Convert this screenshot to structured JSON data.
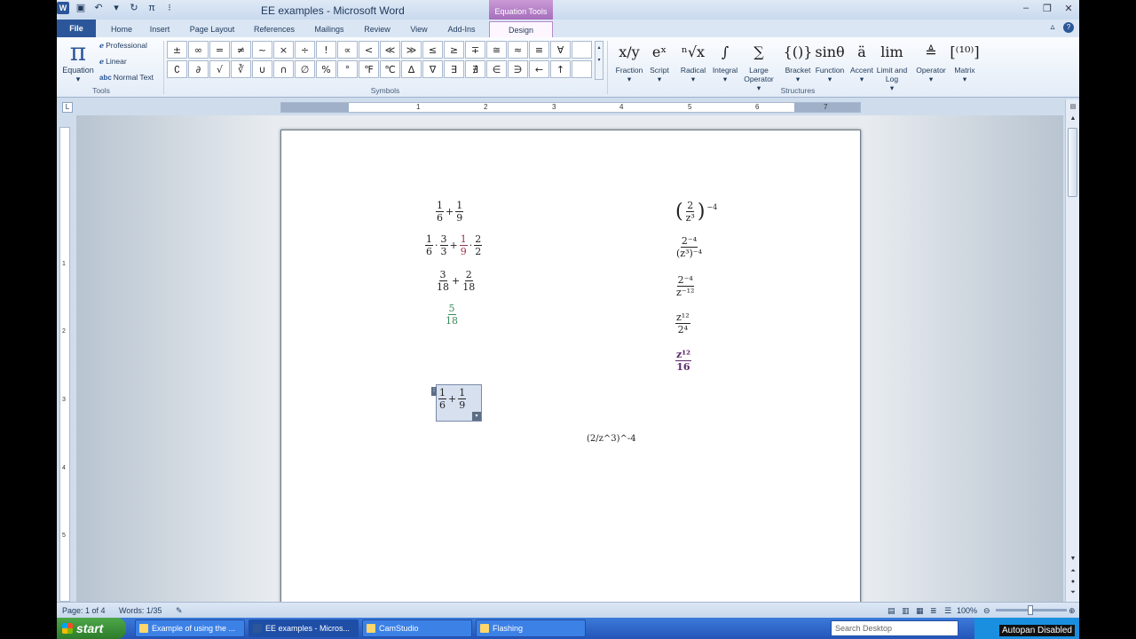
{
  "window": {
    "title": "EE examples - Microsoft Word",
    "context_tab": "Equation Tools"
  },
  "tabs": [
    "File",
    "Home",
    "Insert",
    "Page Layout",
    "References",
    "Mailings",
    "Review",
    "View",
    "Add-Ins",
    "Design"
  ],
  "ribbon": {
    "tools": {
      "equation_label": "Equation",
      "professional": "Professional",
      "linear": "Linear",
      "normal_text": "Normal Text",
      "group_label": "Tools"
    },
    "symbols": {
      "group_label": "Symbols",
      "items": [
        "±",
        "∞",
        "=",
        "≠",
        "~",
        "×",
        "÷",
        "!",
        "∝",
        "<",
        "≪",
        "≫",
        "≤",
        "≥",
        "∓",
        "≅",
        "≈",
        "≡",
        "∀",
        "",
        "∁",
        "∂",
        "√",
        "∛",
        "∪",
        "∩",
        "∅",
        "%",
        "°",
        "℉",
        "℃",
        "∆",
        "∇",
        "∃",
        "∄",
        "∈",
        "∋",
        "←",
        "↑",
        ""
      ]
    },
    "structures": {
      "group_label": "Structures",
      "items": [
        {
          "glyph": "x/y",
          "label": "Fraction",
          "arrow": "▾"
        },
        {
          "glyph": "eˣ",
          "label": "Script",
          "arrow": "▾"
        },
        {
          "glyph": "ⁿ√x",
          "label": "Radical",
          "arrow": "▾"
        },
        {
          "glyph": "∫",
          "label": "Integral",
          "arrow": "▾"
        },
        {
          "glyph": "∑",
          "label": "Large Operator",
          "arrow": "▾"
        },
        {
          "glyph": "{()}",
          "label": "Bracket",
          "arrow": "▾"
        },
        {
          "glyph": "sinθ",
          "label": "Function",
          "arrow": "▾"
        },
        {
          "glyph": "ä",
          "label": "Accent",
          "arrow": "▾"
        },
        {
          "glyph": "lim",
          "label": "Limit and Log",
          "arrow": "▾"
        },
        {
          "glyph": "≜",
          "label": "Operator",
          "arrow": "▾"
        },
        {
          "glyph": "[⁽¹⁰⁾]",
          "label": "Matrix",
          "arrow": "▾"
        }
      ]
    }
  },
  "ruler": {
    "numbers": [
      "1",
      "2",
      "3",
      "4",
      "5",
      "6",
      "7"
    ],
    "vnumbers": [
      "1",
      "2",
      "3",
      "4",
      "5"
    ]
  },
  "document": {
    "left_equations": [
      {
        "parts": [
          [
            "1",
            "6"
          ],
          "+",
          [
            "1",
            "9"
          ]
        ]
      },
      {
        "parts": [
          [
            "1",
            "6"
          ],
          "·",
          [
            "3",
            "3"
          ],
          "+",
          [
            "1",
            "9"
          ],
          "·",
          [
            "2",
            "2"
          ]
        ]
      },
      {
        "parts": [
          [
            "3",
            "18"
          ],
          "+",
          [
            "2",
            "18"
          ]
        ]
      },
      {
        "parts": [
          [
            "5",
            "18"
          ]
        ]
      }
    ],
    "selected_equation": {
      "n1": "1",
      "d1": "6",
      "op": "+",
      "n2": "1",
      "d2": "9"
    },
    "right_equations": [
      {
        "num": "2",
        "den": "z³",
        "exp": "−4"
      },
      {
        "num": "2⁻⁴",
        "den": "(z³)⁻⁴"
      },
      {
        "num": "2⁻⁴",
        "den": "z⁻¹²"
      },
      {
        "num": "z¹²",
        "den": "2⁴"
      },
      {
        "num": "z¹²",
        "den": "16"
      }
    ],
    "linear_text": "(2/z^3)^-4"
  },
  "status": {
    "page": "Page: 1 of 4",
    "words": "Words: 1/35",
    "zoom": "100%",
    "zoom_level": 1.0
  },
  "taskbar": {
    "start": "start",
    "tasks": [
      "Example of using the ...",
      "EE examples - Micros...",
      "CamStudio",
      "Flashing"
    ],
    "search_placeholder": "Search Desktop",
    "autopan": "Autopan Disabled"
  }
}
